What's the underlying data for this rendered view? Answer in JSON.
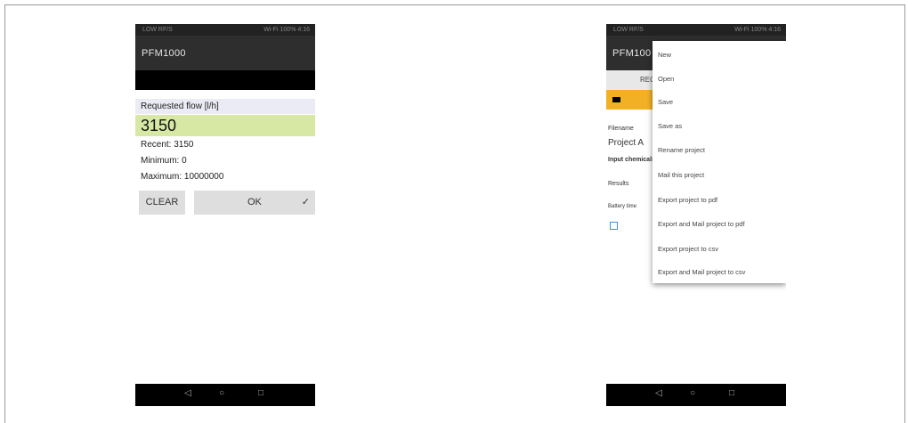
{
  "left_phone": {
    "status_left": "LOW RF/S",
    "status_right": "Wi-Fi 100% 4:16",
    "app_title": "PFM1000",
    "dialog": {
      "label": "Requested flow [l/h]",
      "value": "3150",
      "recent": "Recent: 3150",
      "minimum": "Minimum: 0",
      "maximum": "Maximum: 10000000"
    },
    "buttons": {
      "clear": "CLEAR",
      "ok": "OK",
      "ok_check": "✓"
    }
  },
  "right_phone": {
    "status_left": "LOW RF/S",
    "status_right": "Wi-Fi 100% 4:16",
    "app_title": "PFM100",
    "tab_label": "REQ",
    "rows": {
      "row1": "Filename",
      "row2": "Project A",
      "row3": "Input chemicals",
      "row4": "Results",
      "row5": "Battery time"
    },
    "menu_items": [
      "New",
      "Open",
      "Save",
      "Save as",
      "Rename project",
      "Mail this project",
      "Export project to pdf",
      "Export and Mail project to pdf",
      "Export project to csv",
      "Export and Mail project to csv"
    ]
  },
  "navbar": {
    "back": "◁",
    "home": "○",
    "recent": "□"
  }
}
